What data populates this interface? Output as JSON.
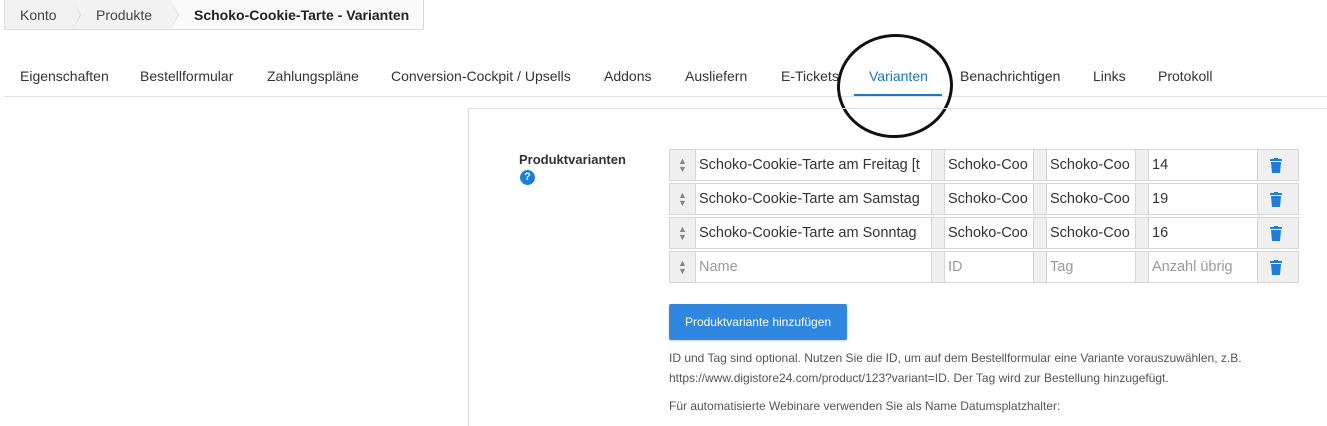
{
  "breadcrumb": {
    "items": [
      "Konto",
      "Produkte",
      "Schoko-Cookie-Tarte - Varianten"
    ]
  },
  "tabs": [
    {
      "label": "Eigenschaften"
    },
    {
      "label": "Bestellformular"
    },
    {
      "label": "Zahlungspläne"
    },
    {
      "label": "Conversion-Cockpit / Upsells"
    },
    {
      "label": "Addons"
    },
    {
      "label": "Ausliefern"
    },
    {
      "label": "E-Tickets"
    },
    {
      "label": "Varianten",
      "active": true
    },
    {
      "label": "Benachrichtigen"
    },
    {
      "label": "Links"
    },
    {
      "label": "Protokoll"
    }
  ],
  "variants": {
    "label": "Produktvarianten",
    "rows": [
      {
        "name": "Schoko-Cookie-Tarte am Freitag [t",
        "id": "Schoko-Coo",
        "tag": "Schoko-Coo",
        "count": "14"
      },
      {
        "name": "Schoko-Cookie-Tarte am Samstag",
        "id": "Schoko-Coo",
        "tag": "Schoko-Coo",
        "count": "19"
      },
      {
        "name": "Schoko-Cookie-Tarte am Sonntag",
        "id": "Schoko-Coo",
        "tag": "Schoko-Coo",
        "count": "16"
      }
    ],
    "placeholders": {
      "name": "Name",
      "id": "ID",
      "tag": "Tag",
      "count": "Anzahl übrig"
    },
    "add_button": "Produktvariante hinzufügen"
  },
  "hint": {
    "line1": "ID und Tag sind optional. Nutzen Sie die ID, um auf dem Bestellformular eine Variante vorauszuwählen, z.B.",
    "line2": "https://www.digistore24.com/product/123?variant=ID. Der Tag wird zur Bestellung hinzugefügt.",
    "line3": "Für automatisierte Webinare verwenden Sie als Name Datumsplatzhalter:"
  },
  "colors": {
    "accent": "#1d76c2",
    "button": "#2f87e0",
    "trash": "#1f7dd6"
  }
}
